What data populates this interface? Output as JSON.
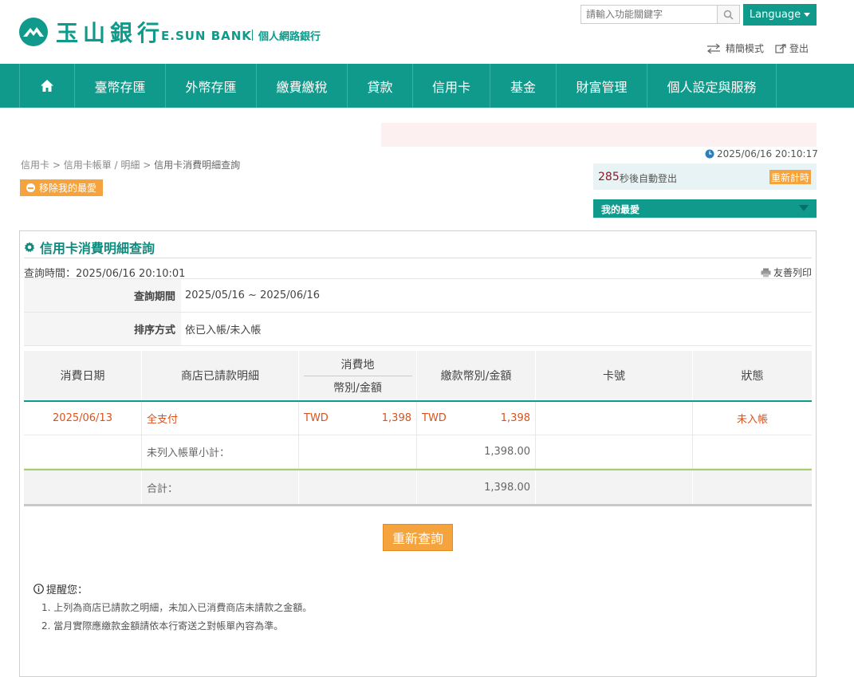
{
  "header": {
    "logo_cn": "玉山銀行",
    "logo_en": "E.SUN BANK",
    "logo_sub": "個人網路銀行",
    "search_placeholder": "請輸入功能關鍵字",
    "language_label": "Language",
    "simple_mode_label": "精簡模式",
    "logout_label": "登出",
    "brand_color": "#0f9a8b"
  },
  "nav": {
    "home_icon": "home-icon",
    "items": [
      {
        "label": "臺幣存匯"
      },
      {
        "label": "外幣存匯"
      },
      {
        "label": "繳費繳稅"
      },
      {
        "label": "貸款"
      },
      {
        "label": "信用卡"
      },
      {
        "label": "基金"
      },
      {
        "label": "財富管理"
      },
      {
        "label": "個人設定與服務"
      }
    ]
  },
  "breadcrumb": {
    "items": [
      "信用卡",
      "信用卡帳單 / 明細",
      "信用卡消費明細查詢"
    ],
    "sep": ">"
  },
  "favorite": {
    "remove_label": "移除我的最愛",
    "my_fav_label": "我的最愛"
  },
  "session": {
    "datetime": "2025/06/16 20:10:17",
    "seconds": "285",
    "countdown_text": "秒後自動登出",
    "reset_label": "重新計時"
  },
  "panel": {
    "title": "信用卡消費明細查詢",
    "query_time": "查詢時間：2025/06/16 20:10:01",
    "print_label": "友善列印",
    "period_label": "查詢期間",
    "period_value": "2025/05/16 ~ 2025/06/16",
    "sort_label": "排序方式",
    "sort_value": "依已入帳/未入帳"
  },
  "table": {
    "headers": {
      "date": "消費日期",
      "merchant": "商店已請款明細",
      "location_top": "消費地",
      "location_bottom": "幣別/金額",
      "payment": "繳款幣別/金額",
      "card": "卡號",
      "status": "狀態"
    },
    "rows": [
      {
        "date": "2025/06/13",
        "merchant": "全支付",
        "loc_currency": "TWD",
        "loc_amount": "1,398",
        "pay_currency": "TWD",
        "pay_amount": "1,398",
        "card": "",
        "status": "未入帳"
      }
    ],
    "subtotal": {
      "label": "未列入帳單小計：",
      "amount": "1,398.00"
    },
    "total": {
      "label": "合計：",
      "amount": "1,398.00"
    }
  },
  "requery_label": "重新查詢",
  "reminder": {
    "title": "提醒您：",
    "items": [
      "1. 上列為商店已請款之明細，未加入已消費商店未請款之金額。",
      "2. 當月實際應繳款金額請依本行寄送之對帳單內容為準。"
    ]
  },
  "colors": {
    "accent": "#0f9a8b",
    "orange": "#f5a33c",
    "alert": "#d9531e"
  }
}
